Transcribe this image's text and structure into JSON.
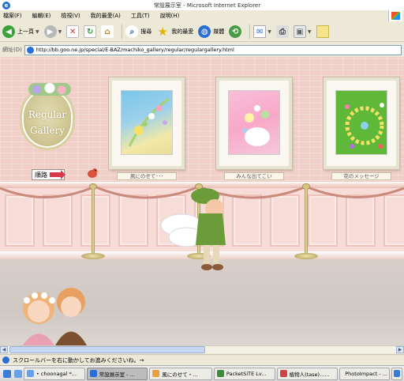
{
  "window": {
    "title": "常設展示室 - Microsoft Internet Explorer"
  },
  "menu": [
    "檔案(F)",
    "編輯(E)",
    "檢視(V)",
    "我的最愛(A)",
    "工具(T)",
    "說明(H)"
  ],
  "toolbar": {
    "back_label": "上一頁",
    "search_label": "搜尋",
    "favorites_label": "我的最愛",
    "media_label": "媒體"
  },
  "address": {
    "label": "網址(D)",
    "url": "http://bb.goo.ne.jp/special/E-BAZ/machiko_gallery/regular/regulargallery.html"
  },
  "page": {
    "plaque_line1": "Regular",
    "plaque_line2": "Gallery",
    "route_label": "順路",
    "captions": [
      "風にのせて･･･",
      "みんな出てこい",
      "花のメッセージ"
    ],
    "colors": {
      "wall": "#f1cfc9",
      "floor": "#d8cfc9",
      "frame": "#fbf7f1",
      "plaque": "#cfc592"
    }
  },
  "status": {
    "text": "スクロールバーを右に動かしてお進みくださいね。→"
  },
  "taskbar": {
    "tasks": [
      {
        "label": "• choonagal *...",
        "color": "#6aa0e8"
      },
      {
        "label": "常設展示室 - ...",
        "color": "#2a6fd6"
      },
      {
        "label": "風にのせて・...",
        "color": "#e8a040"
      },
      {
        "label": "PacketSiTE Lv...",
        "color": "#3c8c3c"
      },
      {
        "label": "植物人(tase)......",
        "color": "#c44"
      },
      {
        "label": "PhotoImpact - ...",
        "color": "#8a4cc4"
      },
      {
        "label": "",
        "color": "#3a7bd5"
      }
    ]
  }
}
